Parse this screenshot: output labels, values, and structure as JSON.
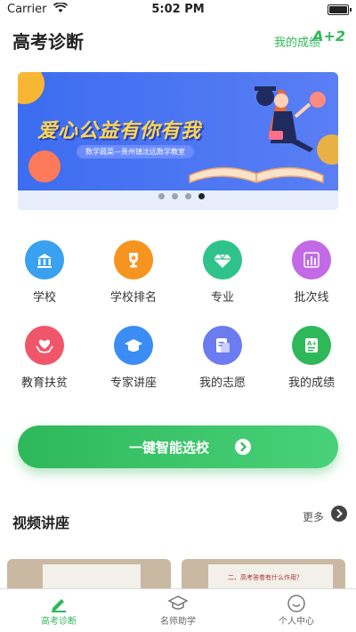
{
  "status": {
    "carrier": "Carrier",
    "time": "5:02 PM"
  },
  "header": {
    "title": "高考诊断",
    "my_grade": "我的成绩",
    "grade_badge": "A+2"
  },
  "banner": {
    "headline": "爱心公益有你有我",
    "subtitle": "数学蔬菜—贵州镇沈远数学教室",
    "slide_count": 4,
    "active_slide": 4
  },
  "grid": [
    {
      "label": "学校",
      "color": "#3aa0f0",
      "icon": "school-building-icon"
    },
    {
      "label": "学校排名",
      "color": "#f5941e",
      "icon": "trophy-icon"
    },
    {
      "label": "专业",
      "color": "#2fc38b",
      "icon": "diamond-icon"
    },
    {
      "label": "批次线",
      "color": "#c26ae6",
      "icon": "bar-chart-icon"
    },
    {
      "label": "教育扶贫",
      "color": "#f0566a",
      "icon": "heart-hands-icon"
    },
    {
      "label": "专家讲座",
      "color": "#3b8df5",
      "icon": "graduation-cap-icon"
    },
    {
      "label": "我的志愿",
      "color": "#6b7bf0",
      "icon": "document-icon"
    },
    {
      "label": "我的成绩",
      "color": "#2fb85a",
      "icon": "grade-sheet-icon"
    }
  ],
  "cta": {
    "label": "一键智能选校"
  },
  "video_section": {
    "title": "视频讲座",
    "more": "更多"
  },
  "thumbnails": [
    {
      "caption": ""
    },
    {
      "caption": "二、高考答卷有什么作用？"
    }
  ],
  "tabs": [
    {
      "label": "高考诊断",
      "icon": "pencil-icon",
      "active": true
    },
    {
      "label": "名师助学",
      "icon": "graduation-cap-icon",
      "active": false
    },
    {
      "label": "个人中心",
      "icon": "smiley-icon",
      "active": false
    }
  ],
  "colors": {
    "accent": "#2fb85a",
    "banner_bg": "#3c6df0"
  }
}
